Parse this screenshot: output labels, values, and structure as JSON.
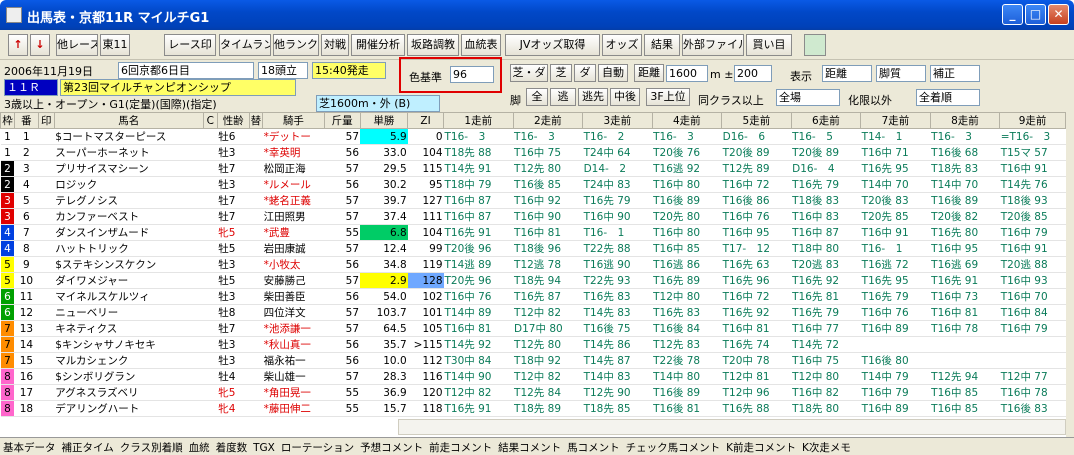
{
  "window": {
    "title": "出馬表・京都11R マイルチG1",
    "minimize": "_",
    "maximize": "□",
    "close": "✕"
  },
  "toolbar": {
    "up": "↑",
    "down": "↓",
    "other_race": "他レース",
    "east11": "東11",
    "race_mark": "レース印",
    "time_rank": "タイムランク",
    "other_rank": "他ランク",
    "matchup": "対戦",
    "open_analysis": "開催分析",
    "slope": "坂路調教",
    "pedigree": "血統表",
    "jv_odds": "JVオッズ取得",
    "odds": "オッズ",
    "result": "結果",
    "external_file": "外部ファイル",
    "buy": "買い目"
  },
  "info": {
    "date": "2006年11月19日",
    "meeting": "6回京都6日目",
    "heads": "18頭立",
    "post_time": "15:40発走",
    "race_no": "１１Ｒ",
    "race_name": "第23回マイルチャンピオンシップ",
    "conditions": "3歳以上・オープン・G1(定量)(国際)(指定)",
    "track": "芝1600m・外 (B)",
    "color_label": "色基準",
    "color_value": "96",
    "surface_options": [
      "芝・ダ",
      "芝",
      "ダ",
      "自動"
    ],
    "distance_label": "距離",
    "distance_value": "1600",
    "distance_pm": "m ±",
    "distance_range": "200",
    "display_label": "表示",
    "display_sel": [
      "距離",
      "脚質",
      "補正"
    ],
    "leg_label": "脚",
    "leg_options": [
      "全",
      "逃",
      "逃先",
      "中後"
    ],
    "f3_top": "3F上位",
    "same_class": "同クラス以上",
    "venue_sel": "全場",
    "limit_label": "化限以外",
    "order_sel": "全着順"
  },
  "columns": {
    "waku": "枠",
    "num": "番",
    "mark": "印",
    "name": "馬名",
    "c": "C",
    "sex": "性齢",
    "chg": "替",
    "jockey": "騎手",
    "weight": "斤量",
    "odds": "単勝",
    "zi": "ZI",
    "past": [
      "1走前",
      "2走前",
      "3走前",
      "4走前",
      "5走前",
      "6走前",
      "7走前",
      "8走前",
      "9走前"
    ]
  },
  "horses": [
    {
      "waku": "1",
      "num": "1",
      "name": "$コートマスターピース",
      "sex": "牡6",
      "jockey": "*デットー",
      "kg": "57",
      "odds": "5.9",
      "zi": "0",
      "past": [
        "T16-　3",
        "T16-　3",
        "T16-　2",
        "T16-　3",
        "D16-　6",
        "T16-　5",
        "T14-　1",
        "T16-　3",
        "=T16-　3"
      ]
    },
    {
      "waku": "1",
      "num": "2",
      "name": "スーパーホーネット",
      "sex": "牡3",
      "jockey": "*幸英明",
      "kg": "56",
      "odds": "33.0",
      "zi": "104",
      "past": [
        "T18先 88",
        "T16中 75",
        "T24中 64",
        "T20後 76",
        "T20後 89",
        "T20後 89",
        "T16中 71",
        "T16後 68",
        "T15マ 57"
      ]
    },
    {
      "waku": "2",
      "num": "3",
      "name": "プリサイスマシーン",
      "sex": "牡7",
      "jockey": "松岡正海",
      "kg": "57",
      "odds": "29.5",
      "zi": "115",
      "past": [
        "T14先 91",
        "T12先 80",
        "D14-　2",
        "T16逃 92",
        "T12先 89",
        "D16-　4",
        "T16先 95",
        "T18先 83",
        "T16中 91"
      ]
    },
    {
      "waku": "2",
      "num": "4",
      "name": "ロジック",
      "sex": "牡3",
      "jockey": "*ルメール",
      "kg": "56",
      "odds": "30.2",
      "zi": "95",
      "past": [
        "T18中 79",
        "T16後 85",
        "T24中 83",
        "T16中 80",
        "T16中 72",
        "T16先 79",
        "T14中 70",
        "T14中 70",
        "T14先 76"
      ]
    },
    {
      "waku": "3",
      "num": "5",
      "name": "テレグノシス",
      "sex": "牡7",
      "jockey": "*蛯名正義",
      "kg": "57",
      "odds": "39.7",
      "zi": "127",
      "past": [
        "T16中 87",
        "T16中 92",
        "T16先 79",
        "T16後 89",
        "T16後 86",
        "T18後 83",
        "T20後 83",
        "T16後 89",
        "T18後 93"
      ]
    },
    {
      "waku": "3",
      "num": "6",
      "name": "カンファーベスト",
      "sex": "牡7",
      "jockey": "江田照男",
      "kg": "57",
      "odds": "37.4",
      "zi": "111",
      "past": [
        "T16中 87",
        "T16中 90",
        "T16中 90",
        "T20先 80",
        "T16中 76",
        "T16中 83",
        "T20先 85",
        "T20後 82",
        "T20後 85"
      ]
    },
    {
      "waku": "4",
      "num": "7",
      "name": "ダンスインザムード",
      "sex": "牝5",
      "jockey": "*武豊",
      "kg": "55",
      "odds": "6.8",
      "zi": "104",
      "past": [
        "T16先 91",
        "T16中 81",
        "T16-　1",
        "T16中 80",
        "T16中 95",
        "T16中 87",
        "T16中 91",
        "T16先 80",
        "T16中 79"
      ]
    },
    {
      "waku": "4",
      "num": "8",
      "name": "ハットトリック",
      "sex": "牡5",
      "jockey": "岩田康誠",
      "kg": "57",
      "odds": "12.4",
      "zi": "99",
      "past": [
        "T20後 96",
        "T18後 96",
        "T22先 88",
        "T16中 85",
        "T17-　12",
        "T18中 80",
        "T16-　1",
        "T16中 95",
        "T16中 91"
      ]
    },
    {
      "waku": "5",
      "num": "9",
      "name": "$ステキシンスケクン",
      "sex": "牡3",
      "jockey": "*小牧太",
      "kg": "56",
      "odds": "34.8",
      "zi": "119",
      "past": [
        "T14逃 89",
        "T12逃 78",
        "T16逃 90",
        "T16逃 86",
        "T16先 63",
        "T20逃 83",
        "T16逃 72",
        "T16逃 69",
        "T20逃 88"
      ]
    },
    {
      "waku": "5",
      "num": "10",
      "name": "ダイワメジャー",
      "sex": "牡5",
      "jockey": "安藤勝己",
      "kg": "57",
      "odds": "2.9",
      "zi": "128",
      "past": [
        "T20先 96",
        "T18先 94",
        "T22先 93",
        "T16先 89",
        "T16先 96",
        "T16先 92",
        "T16先 95",
        "T16先 91",
        "T16中 93"
      ]
    },
    {
      "waku": "6",
      "num": "11",
      "name": "マイネルスケルツィ",
      "sex": "牡3",
      "jockey": "柴田善臣",
      "kg": "56",
      "odds": "54.0",
      "zi": "102",
      "past": [
        "T16中 76",
        "T16先 87",
        "T16先 83",
        "T12中 80",
        "T16中 72",
        "T16先 81",
        "T16先 79",
        "T16中 73",
        "T16中 70"
      ]
    },
    {
      "waku": "6",
      "num": "12",
      "name": "ニューベリー",
      "sex": "牡8",
      "jockey": "四位洋文",
      "kg": "57",
      "odds": "103.7",
      "zi": "101",
      "past": [
        "T14中 89",
        "T12中 82",
        "T14先 83",
        "T16先 83",
        "T16先 92",
        "T16先 79",
        "T16中 76",
        "T16中 81",
        "T16中 84"
      ]
    },
    {
      "waku": "7",
      "num": "13",
      "name": "キネティクス",
      "sex": "牡7",
      "jockey": "*池添謙一",
      "kg": "57",
      "odds": "64.5",
      "zi": "105",
      "past": [
        "T16中 81",
        "D17中 80",
        "T16後 75",
        "T16後 84",
        "T16中 81",
        "T16中 77",
        "T16中 89",
        "T16中 78",
        "T16中 79"
      ]
    },
    {
      "waku": "7",
      "num": "14",
      "name": "$キンシャサノキセキ",
      "sex": "牡3",
      "jockey": "*秋山真一",
      "kg": "56",
      "odds": "35.7",
      "zi": ">115",
      "past": [
        "T14先 92",
        "T12先 80",
        "T14先 86",
        "T12先 83",
        "T16先 74",
        "T14先 72",
        "",
        "",
        ""
      ]
    },
    {
      "waku": "7",
      "num": "15",
      "name": "マルカシェンク",
      "sex": "牡3",
      "jockey": "福永祐一",
      "kg": "56",
      "odds": "10.0",
      "zi": "112",
      "past": [
        "T30中 84",
        "T18中 92",
        "T14先 87",
        "T22後 78",
        "T20中 78",
        "T16中 75",
        "T16後 80",
        "",
        ""
      ]
    },
    {
      "waku": "8",
      "num": "16",
      "name": "$シンボリグラン",
      "sex": "牡4",
      "jockey": "柴山雄一",
      "kg": "57",
      "odds": "28.3",
      "zi": "116",
      "past": [
        "T14中 90",
        "T12中 82",
        "T14中 83",
        "T14中 80",
        "T12中 81",
        "T12中 80",
        "T14中 79",
        "T12先 94",
        "T12中 77"
      ]
    },
    {
      "waku": "8",
      "num": "17",
      "name": "アグネスラズベリ",
      "sex": "牝5",
      "jockey": "*角田晃一",
      "kg": "55",
      "odds": "36.9",
      "zi": "120",
      "past": [
        "T12中 82",
        "T12先 84",
        "T12先 90",
        "T16後 89",
        "T12中 96",
        "T16中 82",
        "T16中 79",
        "T16中 85",
        "T16中 78"
      ]
    },
    {
      "waku": "8",
      "num": "18",
      "name": "デアリングハート",
      "sex": "牝4",
      "jockey": "*藤田伸二",
      "kg": "55",
      "odds": "15.7",
      "zi": "118",
      "past": [
        "T16先 91",
        "T18先 89",
        "T18先 85",
        "T16後 81",
        "T16先 88",
        "T18先 80",
        "T16中 89",
        "T16中 85",
        "T16後 83"
      ]
    }
  ],
  "tabs": [
    "基本データ",
    "補正タイム",
    "クラス別着順",
    "血統",
    "着度数",
    "TGX",
    "ローテーション",
    "予想コメント",
    "前走コメント",
    "結果コメント",
    "馬コメント",
    "チェック馬コメント",
    "K前走コメント",
    "K次走メモ"
  ],
  "colors": {
    "waku": {
      "1": "#ffffff",
      "2": "#000000",
      "3": "#e00000",
      "4": "#0040e0",
      "5": "#ffff00",
      "6": "#00a000",
      "7": "#ff8c00",
      "8": "#ff66cc"
    },
    "highlight_odds": "#00cc66",
    "favorite": "#ffff00"
  }
}
